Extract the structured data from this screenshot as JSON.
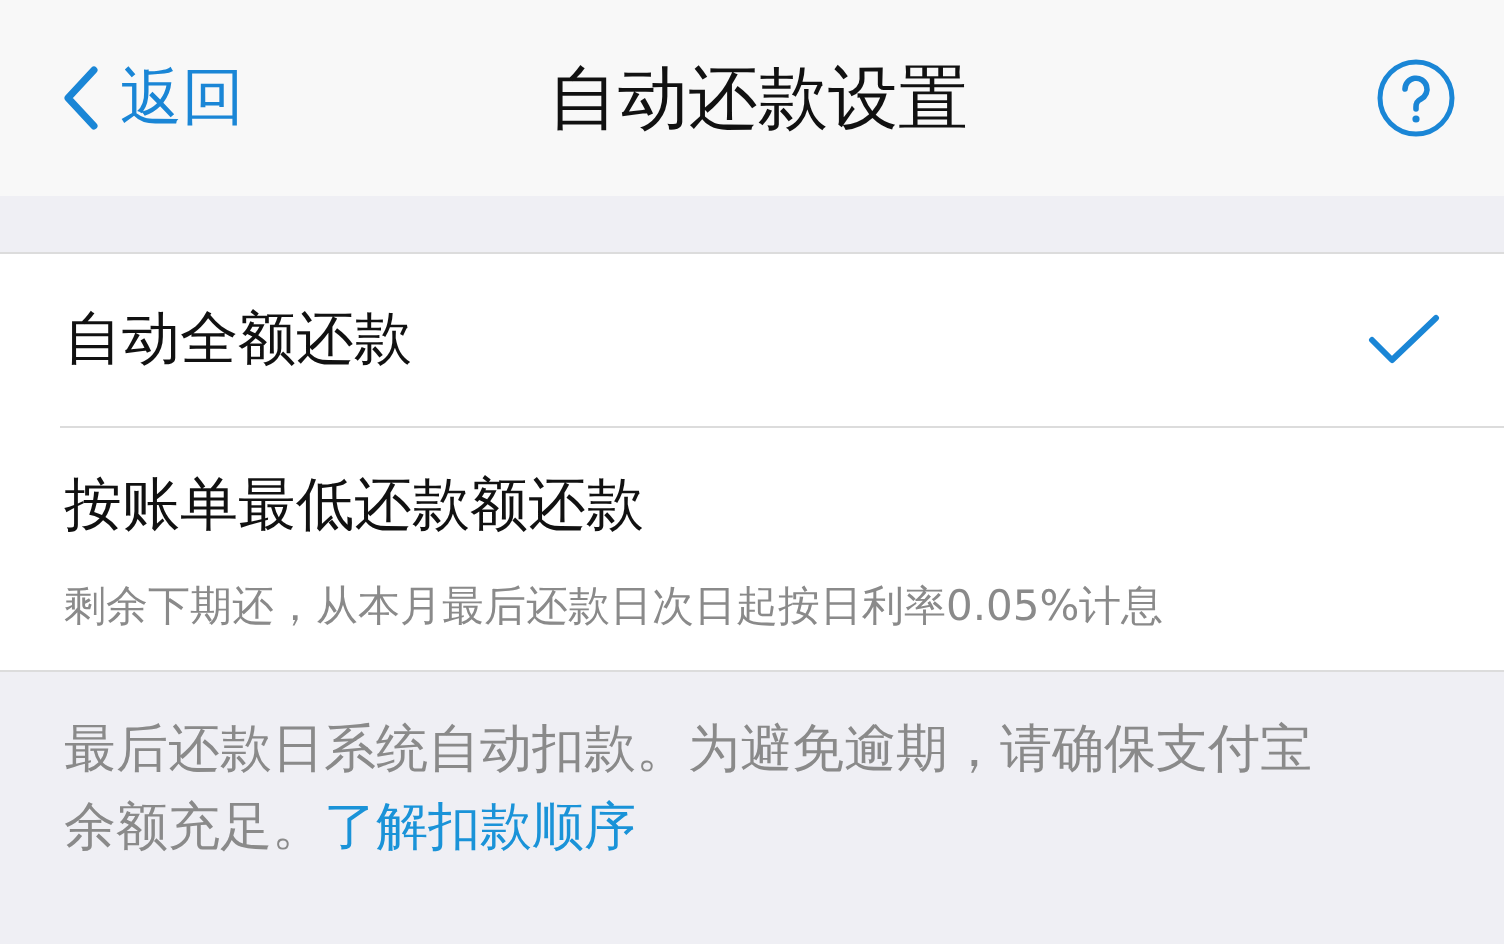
{
  "nav": {
    "back": "返回",
    "title": "自动还款设置"
  },
  "options": [
    {
      "label": "自动全额还款",
      "selected": true
    },
    {
      "label": "按账单最低还款额还款",
      "note": "剩余下期还，从本月最后还款日次日起按日利率0.05%计息",
      "selected": false
    }
  ],
  "footer": {
    "text": "最后还款日系统自动扣款。为避免逾期，请确保支付宝余额充足。",
    "link": "了解扣款顺序"
  }
}
